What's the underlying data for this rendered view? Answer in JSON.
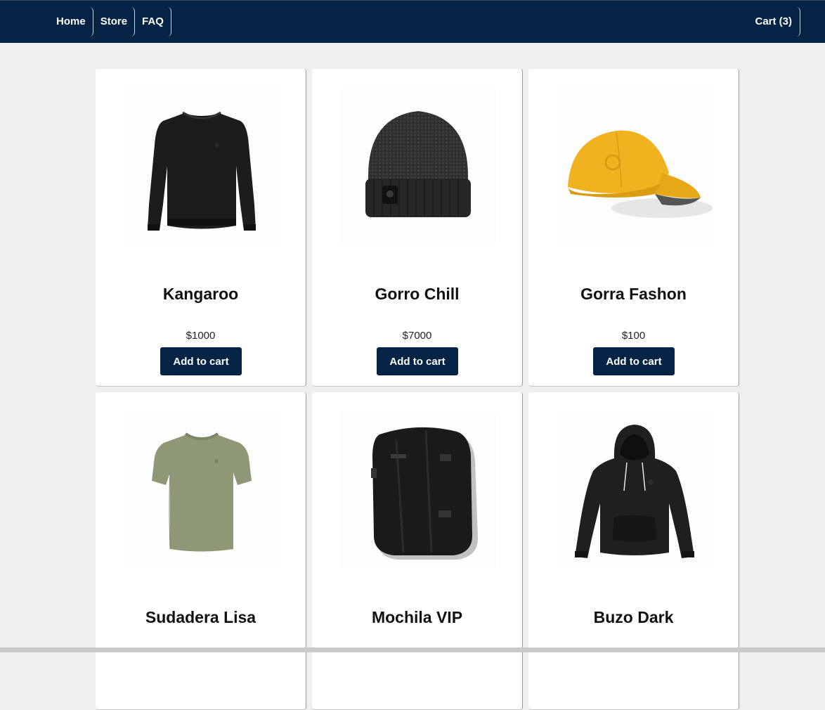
{
  "nav": {
    "links": [
      "Home",
      "Store",
      "FAQ"
    ],
    "cart_label": "Cart (3)"
  },
  "colors": {
    "primary": "#052344",
    "background": "#efefef"
  },
  "products": [
    {
      "name": "Kangaroo",
      "price": "$1000",
      "button": "Add to cart",
      "icon": "sweater-image"
    },
    {
      "name": "Gorro Chill",
      "price": "$7000",
      "button": "Add to cart",
      "icon": "beanie-image"
    },
    {
      "name": "Gorra Fashon",
      "price": "$100",
      "button": "Add to cart",
      "icon": "cap-image"
    },
    {
      "name": "Sudadera Lisa",
      "icon": "tshirt-image"
    },
    {
      "name": "Mochila VIP",
      "icon": "backpack-image"
    },
    {
      "name": "Buzo Dark",
      "icon": "hoodie-image"
    }
  ]
}
